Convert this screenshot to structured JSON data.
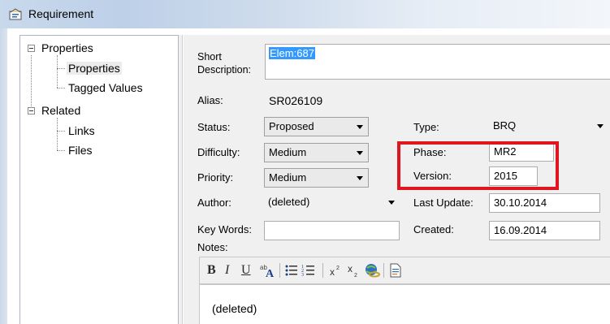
{
  "window": {
    "title": "Requirement"
  },
  "tree": {
    "items": [
      {
        "label": "Properties"
      },
      {
        "label": "Properties"
      },
      {
        "label": "Tagged Values"
      },
      {
        "label": "Related"
      },
      {
        "label": "Links"
      },
      {
        "label": "Files"
      }
    ]
  },
  "form": {
    "short_description": {
      "label_line1": "Short",
      "label_line2": "Description:",
      "value": "Elem:687"
    },
    "alias": {
      "label": "Alias:",
      "value": "SR026109"
    },
    "status": {
      "label": "Status:",
      "value": "Proposed"
    },
    "type": {
      "label": "Type:",
      "value": "BRQ"
    },
    "difficulty": {
      "label": "Difficulty:",
      "value": "Medium"
    },
    "phase": {
      "label": "Phase:",
      "value": "MR2"
    },
    "priority": {
      "label": "Priority:",
      "value": "Medium"
    },
    "version": {
      "label": "Version:",
      "value": "2015"
    },
    "author": {
      "label": "Author:",
      "value": "(deleted)"
    },
    "last_update": {
      "label": "Last Update:",
      "value": "30.10.2014"
    },
    "key_words": {
      "label": "Key Words:",
      "value": ""
    },
    "created": {
      "label": "Created:",
      "value": "16.09.2014"
    },
    "notes": {
      "label": "Notes:",
      "value": "(deleted)"
    }
  },
  "toolbar": {
    "bold": "B",
    "italic": "I",
    "underline": "U",
    "icons": [
      "text-color-icon",
      "bullet-list-icon",
      "numbered-list-icon",
      "superscript-icon",
      "subscript-icon",
      "hyperlink-icon",
      "insert-document-icon"
    ]
  },
  "colors": {
    "highlight_box": "#e0151f",
    "selection": "#3399ff",
    "form_background": "#f0f0f0"
  }
}
